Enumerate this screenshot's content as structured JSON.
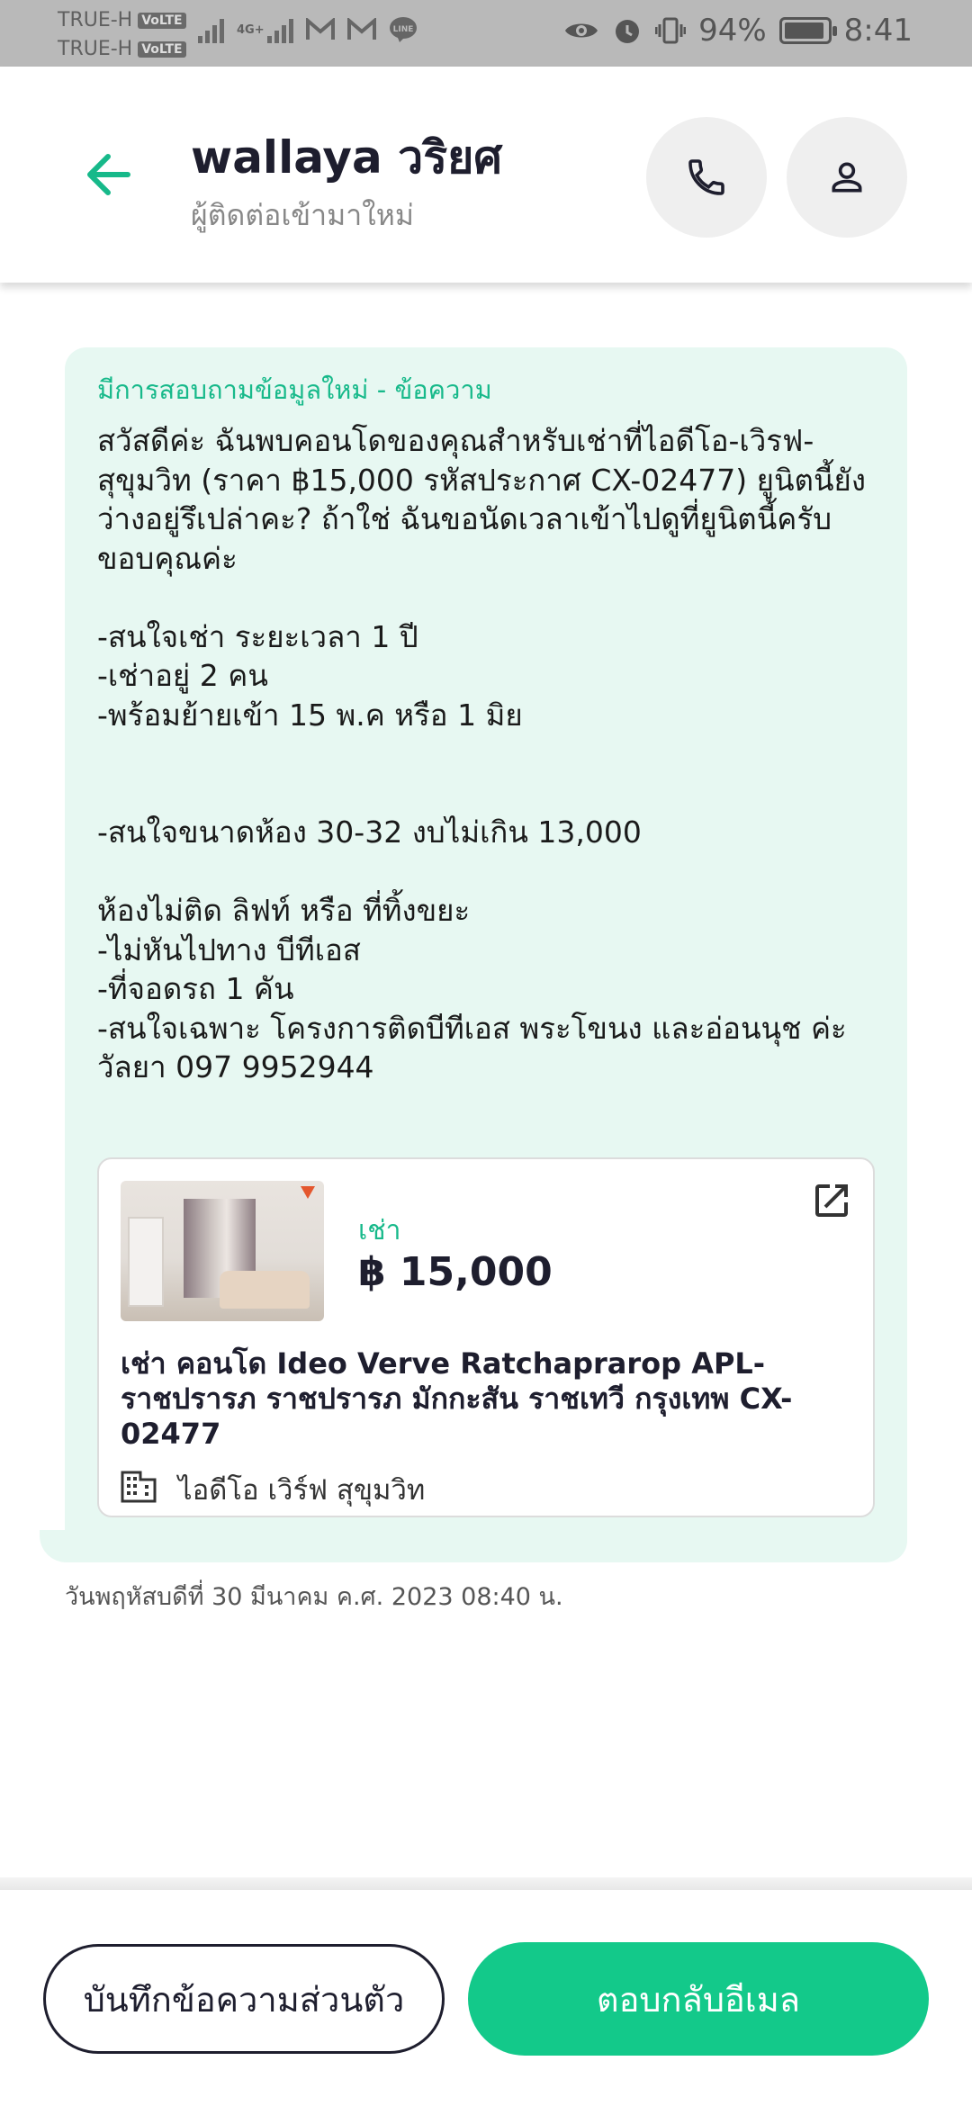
{
  "status_bar": {
    "carrier_line1": "TRUE-H",
    "carrier_line2": "TRUE-H",
    "volte_badge": "VoLTE",
    "network_type": "4G+",
    "battery_percent": "94%",
    "battery_level": 0.94,
    "time": "8:41",
    "icons": [
      "signal-icon",
      "mail-icon",
      "mail-icon",
      "line-app-icon",
      "eye-icon",
      "alarm-icon",
      "vibrate-icon",
      "battery-icon"
    ]
  },
  "header": {
    "contact_name": "wallaya วริยศ",
    "contact_subtitle": "ผู้ติดต่อเข้ามาใหม่",
    "accent_color": "#17b98a"
  },
  "message": {
    "label": "มีการสอบถามข้อมูลใหม่ - ข้อความ",
    "body": "สวัสดีค่ะ ฉันพบคอนโดของคุณสำหรับเช่าที่ไอดีโอ-เวิรฟ-\nสุขุมวิท (ราคา ฿15,000 รหัสประกาศ CX-02477) ยูนิตนี้ยัง\nว่างอยู่รึเปล่าคะ? ถ้าใช่ ฉันขอนัดเวลาเข้าไปดูที่ยูนิตนี้ครับ\nขอบคุณค่ะ\n\n-สนใจเช่า ระยะเวลา 1 ปี\n-เช่าอยู่ 2 คน\n-พร้อมย้ายเข้า 15 พ.ค หรือ 1 มิย\n\n\n-สนใจขนาดห้อง 30-32 งบไม่เกิน 13,000\n\nห้องไม่ติด ลิฟท์ หรือ ที่ทิ้งขยะ\n-ไม่หันไปทาง บีทีเอส\n-ที่จอดรถ 1 คัน\n-สนใจเฉพาะ โครงการติดบีทีเอส พระโขนง และอ่อนนุช ค่ะ\nวัลยา 097 9952944"
  },
  "listing": {
    "type_label": "เช่า",
    "price": "฿ 15,000",
    "title": "เช่า คอนโด  Ideo Verve Ratchaprarop APL-ราชปรารภ ราชปรารภ มักกะสัน ราชเทวี กรุงเทพ CX-02477",
    "project_name": "ไอดีโอ เวิร์ฟ สุขุมวิท"
  },
  "timestamp": "วันพฤหัสบดีที่ 30 มีนาคม ค.ศ. 2023 08:40 น.",
  "actions": {
    "save_note_label": "บันทึกข้อความส่วนตัว",
    "reply_email_label": "ตอบกลับอีเมล",
    "reply_color": "#13c98a"
  }
}
